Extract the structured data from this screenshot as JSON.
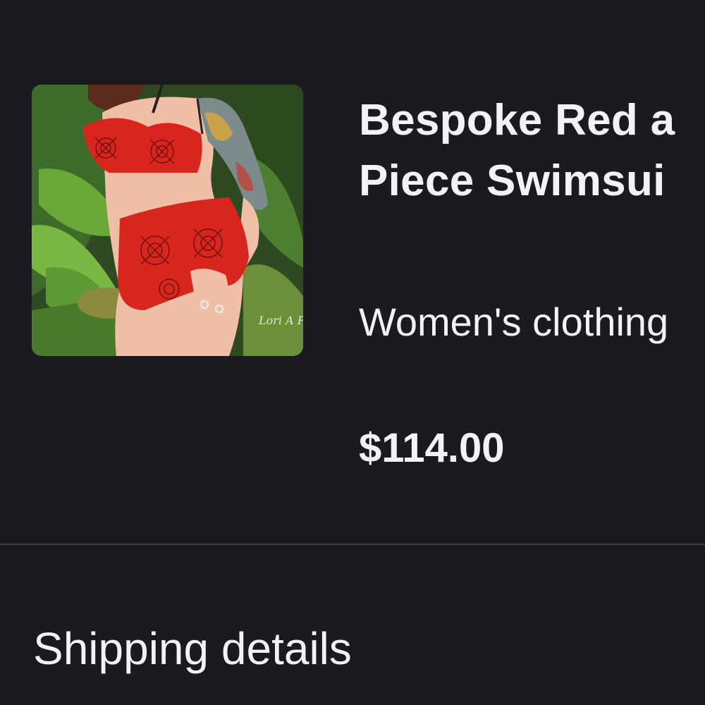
{
  "product": {
    "title_line1": "Bespoke Red a",
    "title_line2": "Piece Swimsui",
    "category": "Women's clothing",
    "price": "$114.00",
    "image_alt": "Red spiderweb print high-waisted bikini",
    "watermark": "Lori A Photography"
  },
  "sections": {
    "shipping_label": "Shipping details"
  },
  "colors": {
    "background": "#1c1a21",
    "text": "#f4f2f5",
    "divider": "#3c3a42",
    "swimsuit_red": "#d8261e"
  }
}
